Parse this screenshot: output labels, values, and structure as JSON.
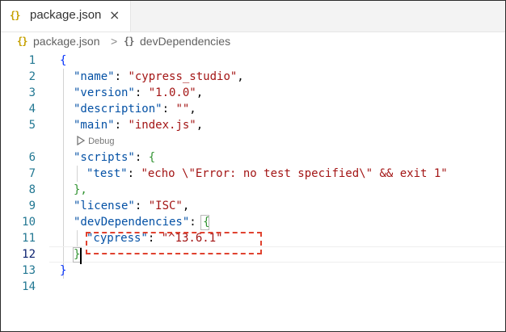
{
  "tab": {
    "icon": "{}",
    "label": "package.json",
    "close_glyph": "×"
  },
  "breadcrumb": {
    "items": [
      {
        "icon": "{}",
        "label": "package.json"
      },
      {
        "icon": "{}",
        "label": "devDependencies"
      }
    ],
    "separator": ">"
  },
  "editor": {
    "current_line": 12,
    "codelens": "Debug",
    "lines": [
      {
        "n": "1"
      },
      {
        "n": "2"
      },
      {
        "n": "3"
      },
      {
        "n": "4"
      },
      {
        "n": "5"
      },
      {
        "n": "6"
      },
      {
        "n": "7"
      },
      {
        "n": "8"
      },
      {
        "n": "9"
      },
      {
        "n": "10"
      },
      {
        "n": "11"
      },
      {
        "n": "12"
      },
      {
        "n": "13"
      },
      {
        "n": "14"
      }
    ],
    "tokens": {
      "open_brace": "{",
      "close_brace": "}",
      "name_key": "\"name\"",
      "name_val": "\"cypress_studio\"",
      "version_key": "\"version\"",
      "version_val": "\"1.0.0\"",
      "description_key": "\"description\"",
      "description_val": "\"\"",
      "main_key": "\"main\"",
      "main_val": "\"index.js\"",
      "scripts_key": "\"scripts\"",
      "test_key": "\"test\"",
      "test_val": "\"echo \\\"Error: no test specified\\\" && exit 1\"",
      "scripts_close": "},",
      "license_key": "\"license\"",
      "license_val": "\"ISC\"",
      "devdeps_key": "\"devDependencies\"",
      "cypress_key": "\"cypress\"",
      "cypress_val": "\"^13.6.1\"",
      "colon": ": ",
      "comma": ","
    }
  },
  "colors": {
    "key": "#0451a5",
    "string": "#a31515",
    "brace_level1": "#0431fa",
    "brace_level2": "#319331",
    "brace_level3": "#7b3814",
    "highlight": "#e0422f",
    "line_number": "#237893"
  }
}
